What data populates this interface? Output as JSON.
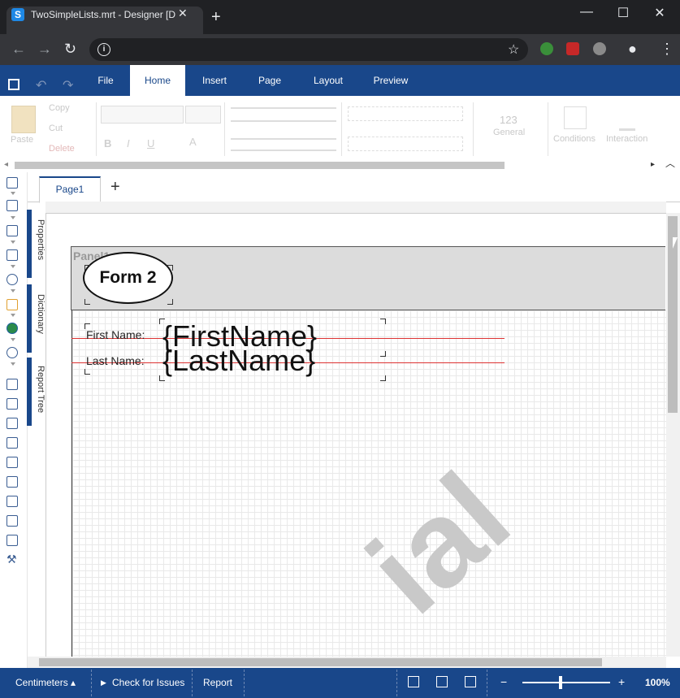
{
  "browser": {
    "tab_title": "TwoSimpleLists.mrt - Designer [D",
    "tab_icon_letter": "S",
    "close_glyph": "✕",
    "newtab_glyph": "+",
    "minimize_glyph": "—",
    "maximize_glyph": "☐",
    "window_close_glyph": "✕",
    "back_glyph": "←",
    "forward_glyph": "→",
    "reload_glyph": "↻",
    "info_glyph": "i",
    "star_glyph": "☆",
    "menu_glyph": "⋮",
    "profile_glyph": "●"
  },
  "app": {
    "undo_glyph": "↶",
    "redo_glyph": "↷",
    "menu_tabs": [
      "File",
      "Home",
      "Insert",
      "Page",
      "Layout",
      "Preview"
    ]
  },
  "ribbon": {
    "paste": "Paste",
    "copy": "Copy",
    "cut": "Cut",
    "delete": "Delete",
    "bold": "B",
    "italic": "I",
    "underline": "U",
    "font_color": "A",
    "number_format_preview": "123",
    "number_format_label": "General",
    "conditions": "Conditions",
    "interaction": "Interaction",
    "scroll_left": "◂",
    "scroll_right": "▸",
    "collapse": "︿"
  },
  "side_panels": [
    "Properties",
    "Dictionary",
    "Report Tree"
  ],
  "pages": {
    "tabs": [
      "Page1"
    ],
    "add_glyph": "+"
  },
  "report": {
    "panel_name": "Panel1",
    "form_title": "Form 2",
    "first_name_label": "First Name:",
    "first_name_field": "{FirstName}",
    "last_name_label": "Last Name:",
    "last_name_field": "{LastName}",
    "watermark": "ial"
  },
  "statusbar": {
    "units": "Centimeters ▴",
    "check_issues": "Check for Issues",
    "check_glyph": "▶",
    "report": "Report",
    "zoom_out": "−",
    "zoom_in": "+",
    "zoom": "100%"
  },
  "colors": {
    "accent": "#19478a",
    "browser_bg": "#202124",
    "red_line": "#dd3333"
  }
}
